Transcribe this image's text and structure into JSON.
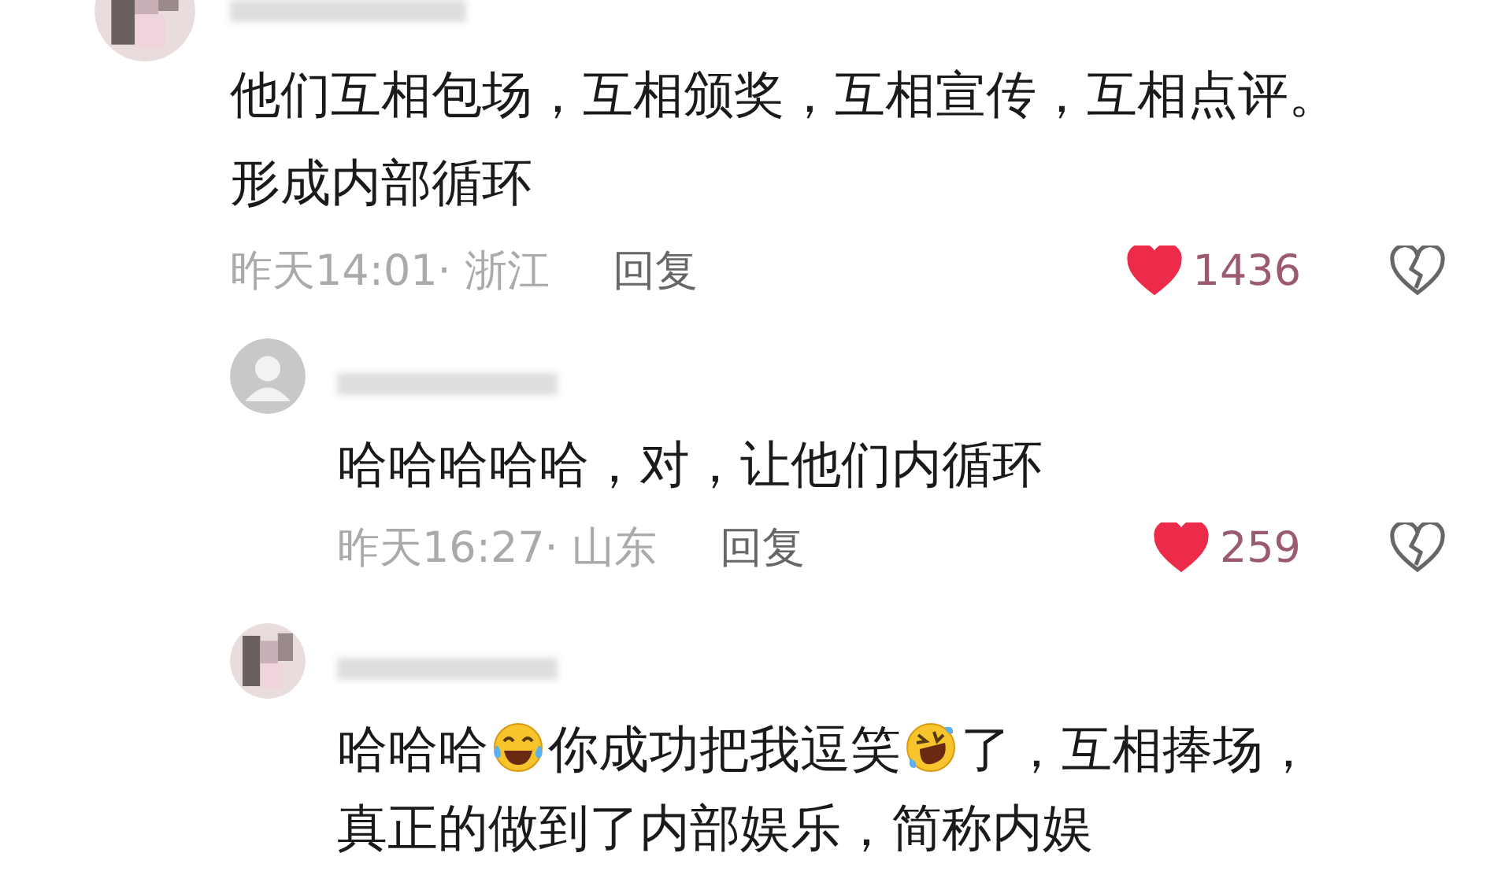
{
  "comments": [
    {
      "avatar": {
        "kind": "photo"
      },
      "lines": [
        [
          {
            "kind": "text",
            "text": "他们互相包场，互相颁奖，互相宣传，互相点评。"
          }
        ],
        [
          {
            "kind": "text",
            "text": "形成内部循环"
          }
        ]
      ],
      "time": "昨天14:01· 浙江",
      "reply": "回复",
      "likes": "1436",
      "liked": true,
      "children": [
        {
          "avatar": {
            "kind": "default"
          },
          "lines": [
            [
              {
                "kind": "text",
                "text": "哈哈哈哈哈，对，让他们内循环"
              }
            ]
          ],
          "time": "昨天16:27· 山东",
          "reply": "回复",
          "likes": "259",
          "liked": true
        },
        {
          "avatar": {
            "kind": "photo"
          },
          "lines": [
            [
              {
                "kind": "text",
                "text": "哈哈哈"
              },
              {
                "kind": "tearsjoy"
              },
              {
                "kind": "text",
                "text": "你成功把我逗笑"
              },
              {
                "kind": "rofl"
              },
              {
                "kind": "text",
                "text": "了，互相捧场，"
              }
            ],
            [
              {
                "kind": "text",
                "text": "真正的做到了内部娱乐，简称内娱"
              }
            ]
          ]
        }
      ]
    }
  ]
}
